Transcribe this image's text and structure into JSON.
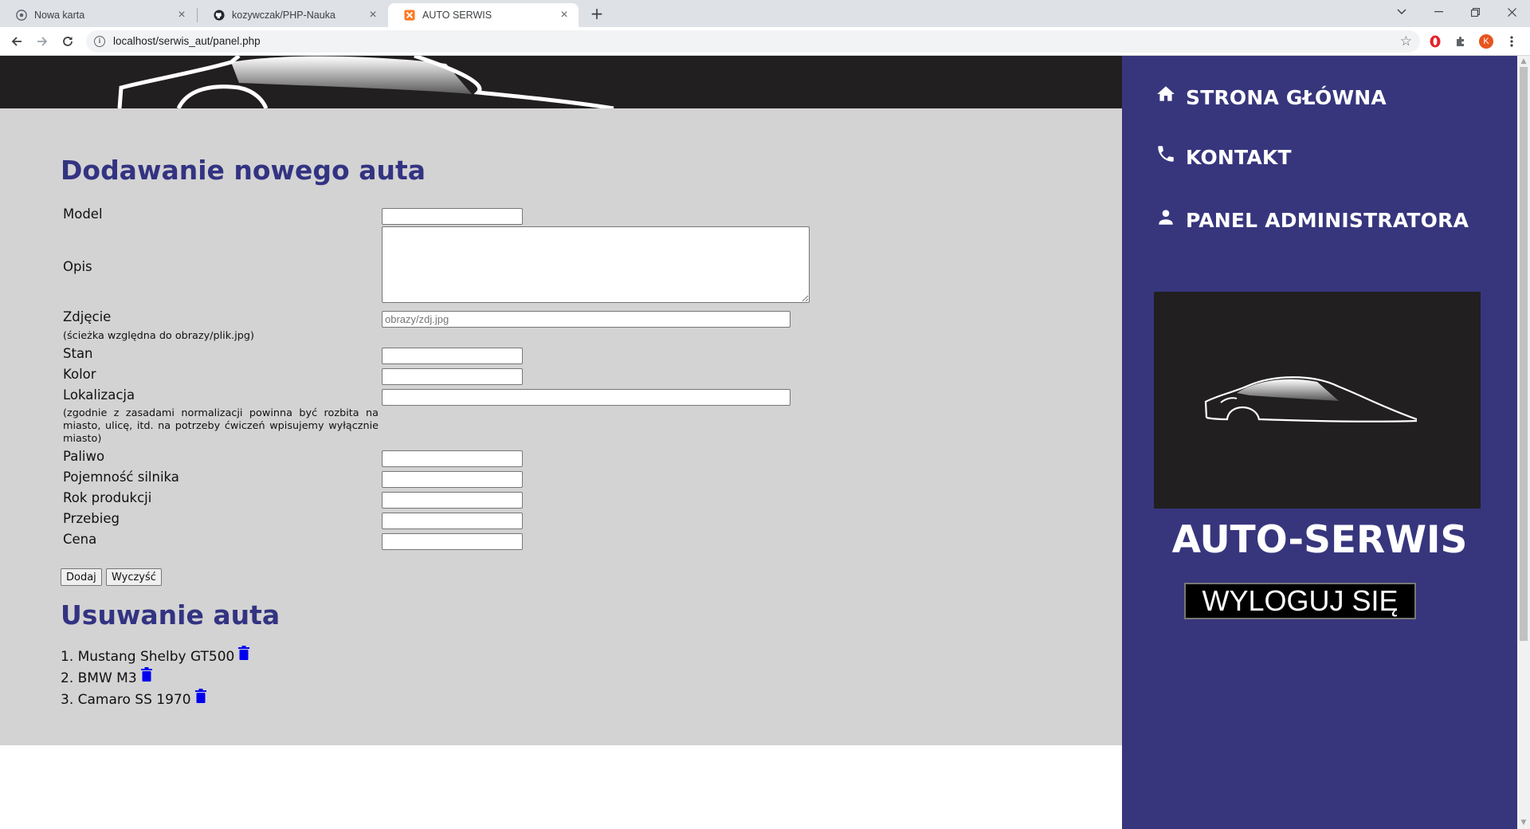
{
  "browser": {
    "tabs": [
      {
        "title": "Nowa karta"
      },
      {
        "title": "kozywczak/PHP-Nauka"
      },
      {
        "title": "AUTO SERWIS"
      }
    ],
    "url": "localhost/serwis_aut/panel.php",
    "profile_initial": "K"
  },
  "form": {
    "title": "Dodawanie nowego auta",
    "fields": {
      "model": {
        "label": "Model",
        "value": ""
      },
      "opis": {
        "label": "Opis",
        "value": ""
      },
      "zdjecie": {
        "label": "Zdjęcie",
        "hint": "(ścieżka względna do obrazy/plik.jpg)",
        "placeholder": "obrazy/zdj.jpg"
      },
      "stan": {
        "label": "Stan"
      },
      "kolor": {
        "label": "Kolor"
      },
      "lokalizacja": {
        "label": "Lokalizacja",
        "hint": "(zgodnie z zasadami normalizacji powinna być rozbita na miasto, ulicę, itd. na potrzeby ćwiczeń wpisujemy wyłącznie miasto)"
      },
      "paliwo": {
        "label": "Paliwo"
      },
      "pojemnosc": {
        "label": "Pojemność silnika"
      },
      "rok": {
        "label": "Rok produkcji"
      },
      "przebieg": {
        "label": "Przebieg"
      },
      "cena": {
        "label": "Cena"
      }
    },
    "submit_label": "Dodaj",
    "reset_label": "Wyczyść"
  },
  "delete_section": {
    "title": "Usuwanie auta",
    "items": [
      {
        "text": "1. Mustang Shelby GT500"
      },
      {
        "text": "2. BMW M3"
      },
      {
        "text": "3. Camaro SS 1970"
      }
    ]
  },
  "sidebar": {
    "nav": [
      {
        "label": "STRONA GŁÓWNA",
        "icon": "home-icon"
      },
      {
        "label": "KONTAKT",
        "icon": "phone-icon"
      },
      {
        "label": "PANEL ADMINISTRATORA",
        "icon": "person-icon"
      }
    ],
    "brand": "AUTO-SERWIS",
    "logout_label": "WYLOGUJ SIĘ"
  },
  "colors": {
    "heading": "#333382",
    "sidebar_bg": "#37367d",
    "content_bg": "#d3d3d3",
    "banner_bg": "#221f20",
    "trash_icon": "#0000ee"
  }
}
